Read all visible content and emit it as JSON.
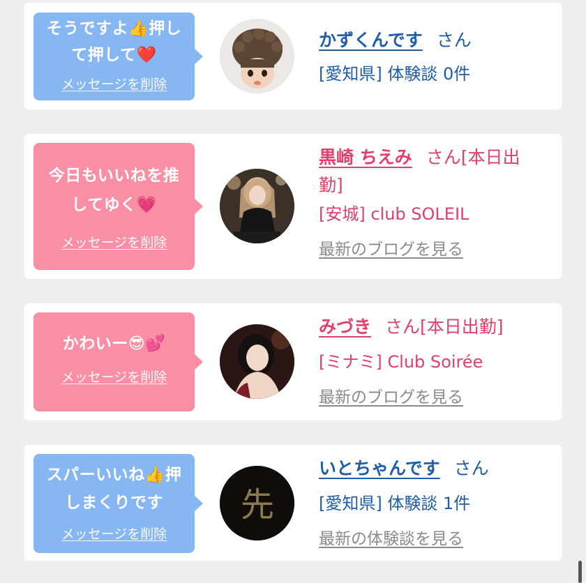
{
  "colors": {
    "blue_bubble": "#87b7f3",
    "pink_bubble": "#f98fa5",
    "blue_text": "#1f5da8",
    "pink_text": "#e0406b",
    "link_gray": "#8a8a8a"
  },
  "cards": [
    {
      "message_line1": "そうですよ👍押し",
      "message_line2": "て押して❤️",
      "delete_label": "メッセージを削除",
      "avatar_icon": "cartoon-avatar-icon",
      "name": "かずくんです",
      "suffix": "さん",
      "detail": "[愛知県] 体験談 0件"
    },
    {
      "message_line1": "今日もいいねを推",
      "message_line2": "してゆく💗",
      "delete_label": "メッセージを削除",
      "avatar_icon": "cast-photo-avatar",
      "name": "黒崎 ちえみ",
      "suffix": "さん[本日出",
      "suffix_line2": "勤]",
      "detail": "[安城] club SOLEIL",
      "link": "最新のブログを見る"
    },
    {
      "message_line1": "かわいー😎💕",
      "delete_label": "メッセージを削除",
      "avatar_icon": "cast-photo-avatar",
      "name": "みづき",
      "suffix": "さん[本日出勤]",
      "detail": "[ミナミ] Club Soirée",
      "link": "最新のブログを見る"
    },
    {
      "message_line1": "スパーいいね👍押",
      "message_line2": "しまくりです",
      "delete_label": "メッセージを削除",
      "avatar_icon": "dark-kanji-avatar",
      "avatar_char": "先",
      "name": "いとちゃんです",
      "suffix": "さん",
      "detail": "[愛知県] 体験談 1件",
      "link": "最新の体験談を見る"
    }
  ]
}
